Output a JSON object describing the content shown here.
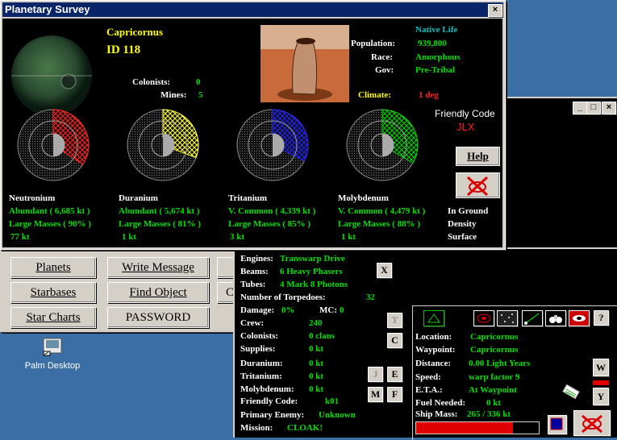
{
  "desktop": {
    "icon_label": "Palm Desktop"
  },
  "survey": {
    "title": "Planetary Survey",
    "close": "×",
    "planet_name": "Capricornus",
    "planet_id": "ID  118",
    "colonists_label": "Colonists:",
    "colonists": "0",
    "mines_label": "Mines:",
    "mines": "5",
    "native_life_label": "Native Life",
    "population_label": "Population:",
    "population": "939,800",
    "race_label": "Race:",
    "race": "Amorphous",
    "gov_label": "Gov:",
    "gov": "Pre-Tribal",
    "climate_label": "Climate:",
    "climate": "1 deg",
    "friendly_code_label": "Friendly Code",
    "friendly_code": "JLX",
    "help_label": "Help",
    "minerals": [
      {
        "name": "Neutronium",
        "abundance": "Abundant  ( 6,685 kt )",
        "masses": "Large Masses  ( 90% )",
        "surface": "77 kt",
        "color": "#ff2020",
        "pct": 0.9
      },
      {
        "name": "Duranium",
        "abundance": "Abundant  ( 5,674 kt )",
        "masses": "Large Masses  ( 81% )",
        "surface": "1 kt",
        "color": "#ffff40",
        "pct": 0.81
      },
      {
        "name": "Tritanium",
        "abundance": "V. Common  ( 4,339 kt )",
        "masses": "Large Masses  ( 85% )",
        "surface": "3 kt",
        "color": "#2020ff",
        "pct": 0.85
      },
      {
        "name": "Molybdenum",
        "abundance": "V. Common  ( 4,479 kt )",
        "masses": "Large Masses  ( 88% )",
        "surface": "1 kt",
        "color": "#00d000",
        "pct": 0.88
      }
    ],
    "legend": [
      "In Ground",
      "Density",
      "Surface"
    ]
  },
  "menu": {
    "planets": "Planets",
    "write_message": "Write Message",
    "starbases": "Starbases",
    "find_object": "Find Object",
    "star_charts": "Star Charts",
    "password": "PASSWORD"
  },
  "ship": {
    "engines_label": "Engines:",
    "engines": "Transwarp Drive",
    "beams_label": "Beams:",
    "beams": "6 Heavy Phasers",
    "tubes_label": "Tubes:",
    "tubes": "4 Mark 8 Photons",
    "torpedoes_label": "Number of Torpedoes:",
    "torpedoes": "32",
    "damage_label": "Damage:",
    "damage": "0%",
    "mc_label": "MC:",
    "mc": "0",
    "crew_label": "Crew:",
    "crew": "240",
    "colonists_label": "Colonists:",
    "colonists": "0 clans",
    "supplies_label": "Supplies:",
    "supplies": "0 kt",
    "duranium_label": "Duranium:",
    "duranium": "0 kt",
    "tritanium_label": "Tritanium:",
    "tritanium": "0 kt",
    "molybdenum_label": "Molybdenum:",
    "molybdenum": "0 kt",
    "fc_label": "Friendly Code:",
    "fc": "k01",
    "enemy_label": "Primary Enemy:",
    "enemy": "Unknown",
    "mission_label": "Mission:",
    "mission": "CLOAK!",
    "btn_x": "X",
    "btn_t": "T",
    "btn_c": "C",
    "btn_j": "J",
    "btn_e": "E",
    "btn_m": "M",
    "btn_f": "F",
    "location_label": "Location:",
    "location": "Capricornus",
    "waypoint_label": "Waypoint:",
    "waypoint": "Capricornus",
    "distance_label": "Distance:",
    "distance": "0.00 Light Years",
    "speed_label": "Speed:",
    "speed": "warp factor  9",
    "eta_label": "E.T.A.:",
    "eta": "At Waypoint",
    "fuel_label": "Fuel Needed:",
    "fuel": "0 kt",
    "mass_label": "Ship Mass:",
    "mass": "265 / 336 kt",
    "btn_w": "W",
    "btn_y": "Y",
    "btn_q": "?",
    "mass_fraction": 0.79
  },
  "window2": {
    "min": "_",
    "max": "□",
    "close": "×"
  }
}
